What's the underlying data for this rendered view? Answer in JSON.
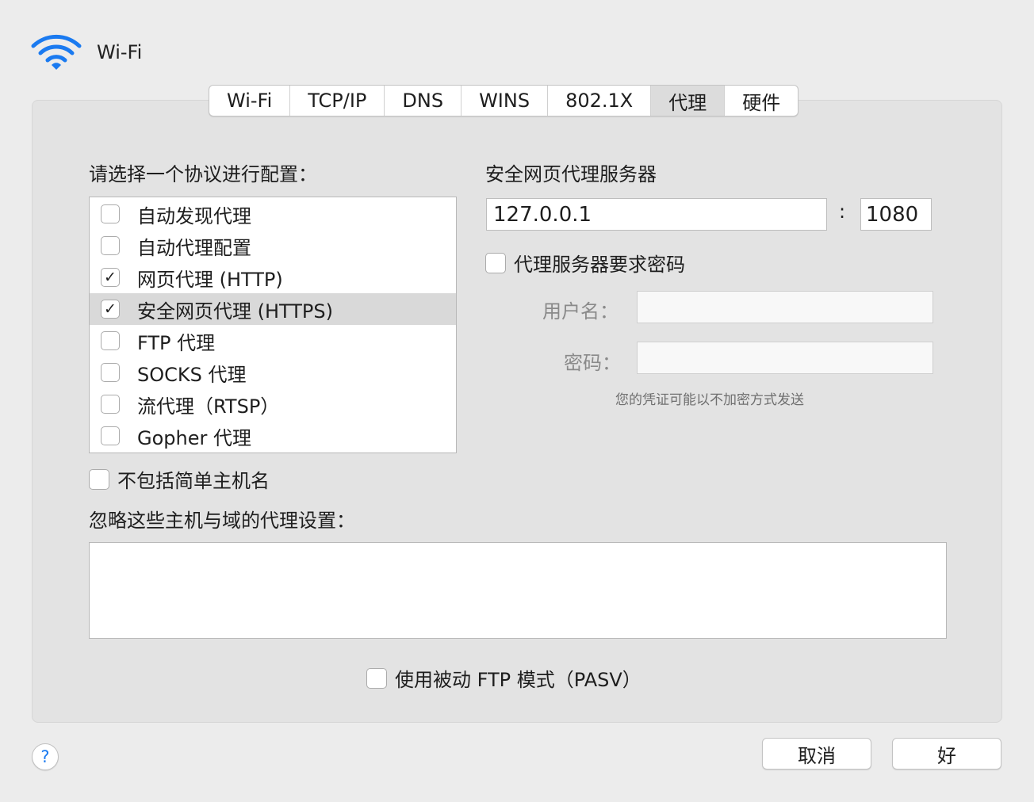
{
  "window": {
    "title": "Wi-Fi"
  },
  "tabs": [
    {
      "label": "Wi-Fi",
      "active": false
    },
    {
      "label": "TCP/IP",
      "active": false
    },
    {
      "label": "DNS",
      "active": false
    },
    {
      "label": "WINS",
      "active": false
    },
    {
      "label": "802.1X",
      "active": false
    },
    {
      "label": "代理",
      "active": true
    },
    {
      "label": "硬件",
      "active": false
    }
  ],
  "protocols": {
    "heading": "请选择一个协议进行配置：",
    "items": [
      {
        "label": "自动发现代理",
        "checked": false,
        "check_mark": "",
        "selected": false
      },
      {
        "label": "自动代理配置",
        "checked": false,
        "check_mark": "",
        "selected": false
      },
      {
        "label": "网页代理 (HTTP)",
        "checked": true,
        "check_mark": "✓",
        "selected": false
      },
      {
        "label": "安全网页代理 (HTTPS)",
        "checked": true,
        "check_mark": "✓",
        "selected": true
      },
      {
        "label": "FTP 代理",
        "checked": false,
        "check_mark": "",
        "selected": false
      },
      {
        "label": "SOCKS 代理",
        "checked": false,
        "check_mark": "",
        "selected": false
      },
      {
        "label": "流代理（RTSP）",
        "checked": false,
        "check_mark": "",
        "selected": false
      },
      {
        "label": "Gopher 代理",
        "checked": false,
        "check_mark": "",
        "selected": false
      }
    ]
  },
  "proxy_server": {
    "heading": "安全网页代理服务器",
    "host": "127.0.0.1",
    "separator": ":",
    "port": "1080",
    "require_password_label": "代理服务器要求密码",
    "require_password_checked": false,
    "username_label": "用户名：",
    "username_value": "",
    "password_label": "密码：",
    "password_value": "",
    "hint": "您的凭证可能以不加密方式发送"
  },
  "exclude_simple_hostnames": {
    "label": "不包括简单主机名",
    "checked": false
  },
  "bypass": {
    "label": "忽略这些主机与域的代理设置：",
    "value": ""
  },
  "passive_ftp": {
    "label": "使用被动 FTP 模式（PASV）",
    "checked": false
  },
  "buttons": {
    "help": "?",
    "cancel": "取消",
    "ok": "好"
  },
  "colors": {
    "wifi_icon": "#1a7af0",
    "panel": "#e3e3e3",
    "selected_row": "#d9d9d9"
  },
  "icons": {
    "header": "wifi-icon"
  }
}
